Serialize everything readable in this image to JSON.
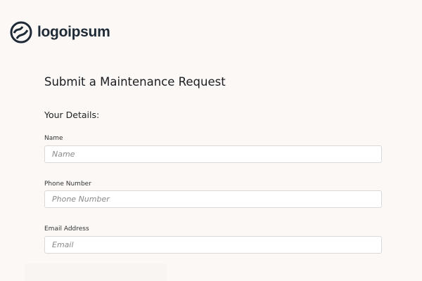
{
  "brand": {
    "name": "logoipsum"
  },
  "form": {
    "title": "Submit a Maintenance Request",
    "section": "Your Details:",
    "fields": [
      {
        "label": "Name",
        "placeholder": "Name",
        "value": ""
      },
      {
        "label": "Phone Number",
        "placeholder": "Phone Number",
        "value": ""
      },
      {
        "label": "Email Address",
        "placeholder": "Email",
        "value": ""
      }
    ]
  }
}
